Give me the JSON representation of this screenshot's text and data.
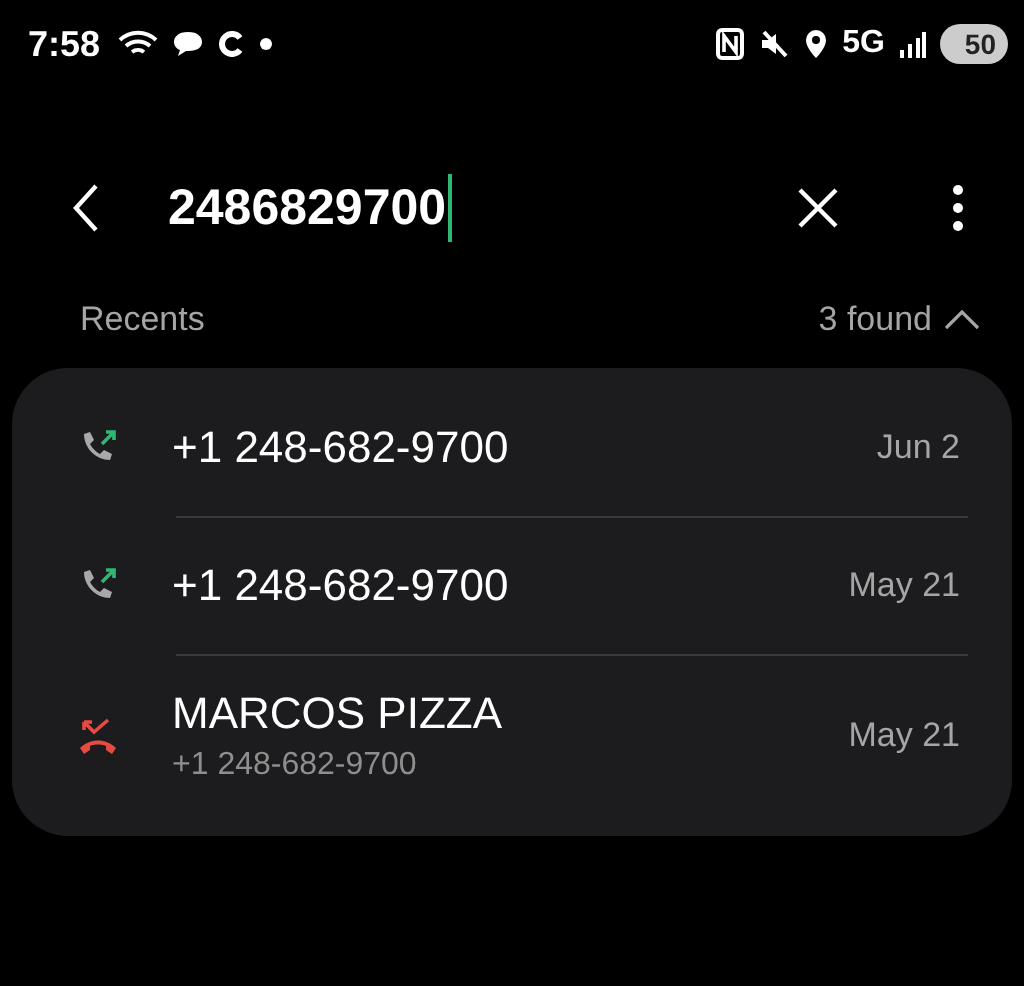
{
  "status_bar": {
    "time": "7:58",
    "network": "5G",
    "battery": "50"
  },
  "search": {
    "value": "2486829700"
  },
  "recents": {
    "label": "Recents",
    "count": "3 found",
    "expanded": true,
    "calls": [
      {
        "kind": "outgoing",
        "name": "+1 248-682-9700",
        "date": "Jun 2"
      },
      {
        "kind": "outgoing",
        "name": "+1 248-682-9700",
        "date": "May 21"
      },
      {
        "kind": "missed",
        "name": "MARCOS PIZZA",
        "number": "+1 248-682-9700",
        "date": "May 21"
      }
    ]
  }
}
